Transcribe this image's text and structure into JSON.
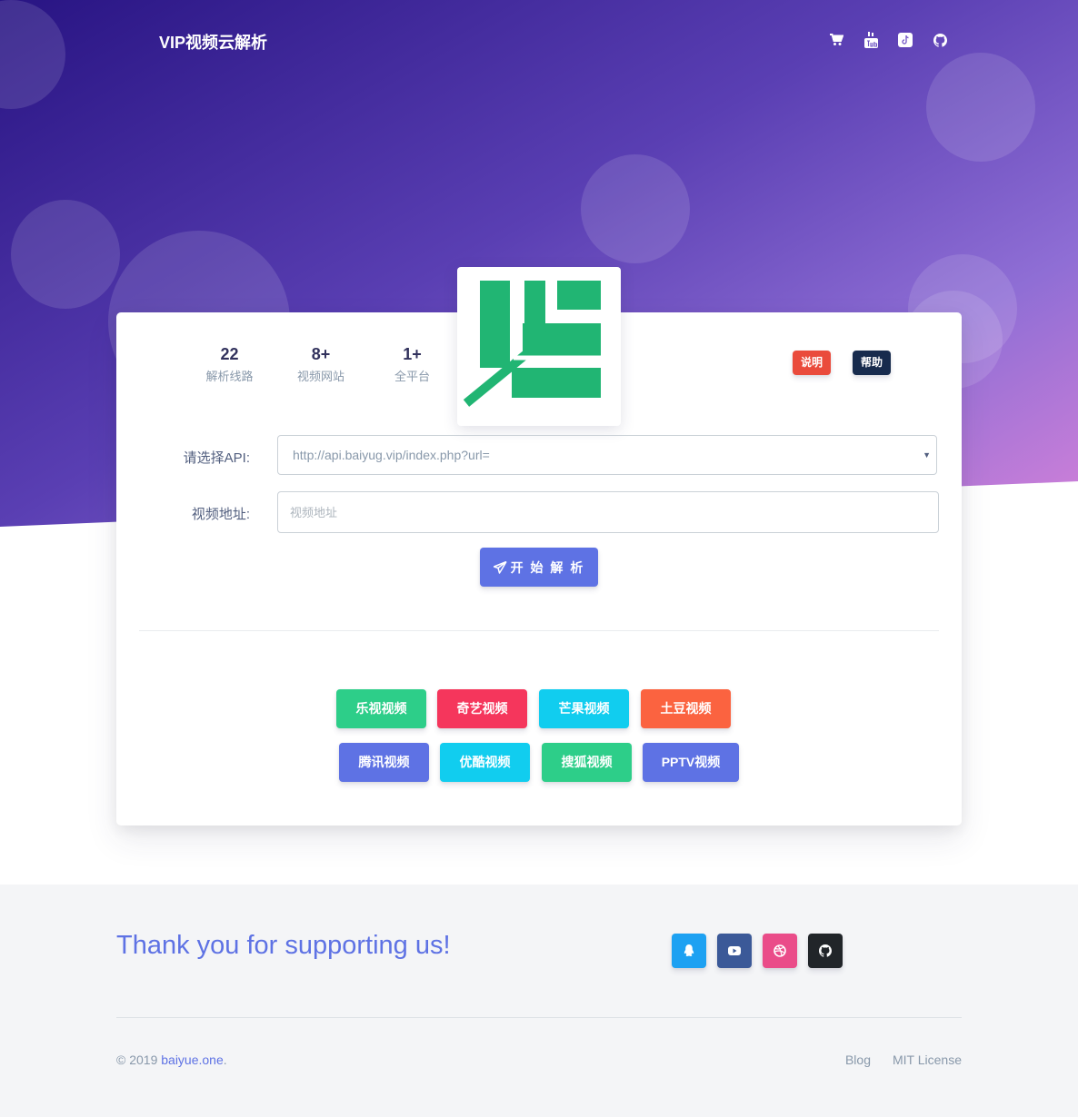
{
  "navbar": {
    "brand": "VIP视频云解析",
    "icons": [
      "cart-icon",
      "youtube-icon",
      "tiktok-icon",
      "github-icon"
    ]
  },
  "stats": [
    {
      "value": "22",
      "label": "解析线路"
    },
    {
      "value": "8+",
      "label": "视频网站"
    },
    {
      "value": "1+",
      "label": "全平台"
    }
  ],
  "buttons": {
    "explain": "说明",
    "help": "帮助",
    "parse": "开 始 解 析"
  },
  "form": {
    "api_label": "请选择API:",
    "api_value": "http://api.baiyug.vip/index.php?url=",
    "video_label": "视频地址:",
    "video_placeholder": "视频地址"
  },
  "sites": [
    {
      "label": "乐视视频",
      "color": "#2dce89"
    },
    {
      "label": "奇艺视频",
      "color": "#f5365c"
    },
    {
      "label": "芒果视频",
      "color": "#11cdef"
    },
    {
      "label": "土豆视频",
      "color": "#fb6340"
    },
    {
      "label": "腾讯视频",
      "color": "#5e72e4"
    },
    {
      "label": "优酷视频",
      "color": "#11cdef"
    },
    {
      "label": "搜狐视频",
      "color": "#2dce89"
    },
    {
      "label": "PPTV视频",
      "color": "#5e72e4"
    }
  ],
  "footer": {
    "thanks": "Thank you for supporting us!",
    "copyright_prefix": "© 2019 ",
    "copyright_link": "baiyue.one",
    "copyright_suffix": ".",
    "links": [
      "Blog",
      "MIT License"
    ],
    "social_icons": [
      "qq-icon",
      "youtube-icon",
      "dribbble-icon",
      "github-icon"
    ]
  },
  "colors": {
    "primary": "#5e72e4",
    "danger": "#f5365c",
    "dark": "#172b4d",
    "logo_green": "#21b573"
  }
}
